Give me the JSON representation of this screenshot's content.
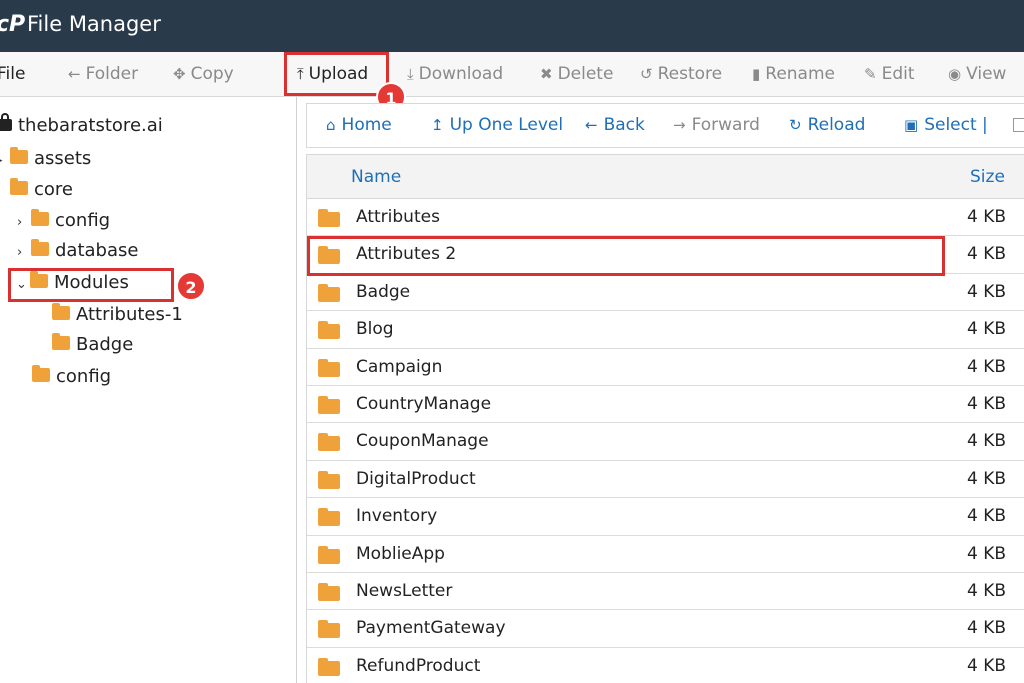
{
  "header": {
    "logo": "cP",
    "title": "File Manager"
  },
  "toolbar": {
    "file": "File",
    "folder": "Folder",
    "copy": "Copy",
    "upload": "Upload",
    "download": "Download",
    "delete": "Delete",
    "restore": "Restore",
    "rename": "Rename",
    "edit": "Edit",
    "view": "View"
  },
  "annotations": {
    "badge1": "1",
    "badge2": "2"
  },
  "sidebar": {
    "root": "thebaratstore.ai",
    "items": [
      "assets",
      "core",
      "config",
      "database",
      "Modules",
      "Attributes-1",
      "Badge",
      "config"
    ]
  },
  "nav": {
    "home": "Home",
    "up": "Up One Level",
    "back": "Back",
    "forward": "Forward",
    "reload": "Reload",
    "select": "Select |"
  },
  "table": {
    "headers": {
      "name": "Name",
      "size": "Size"
    },
    "rows": [
      {
        "name": "Attributes",
        "size": "4 KB"
      },
      {
        "name": "Attributes 2",
        "size": "4 KB"
      },
      {
        "name": "Badge",
        "size": "4 KB"
      },
      {
        "name": "Blog",
        "size": "4 KB"
      },
      {
        "name": "Campaign",
        "size": "4 KB"
      },
      {
        "name": "CountryManage",
        "size": "4 KB"
      },
      {
        "name": "CouponManage",
        "size": "4 KB"
      },
      {
        "name": "DigitalProduct",
        "size": "4 KB"
      },
      {
        "name": "Inventory",
        "size": "4 KB"
      },
      {
        "name": "MoblieApp",
        "size": "4 KB"
      },
      {
        "name": "NewsLetter",
        "size": "4 KB"
      },
      {
        "name": "PaymentGateway",
        "size": "4 KB"
      },
      {
        "name": "RefundProduct",
        "size": "4 KB"
      }
    ]
  },
  "colors": {
    "header_bg": "#293a4a",
    "accent": "#1e6fb8",
    "highlight": "#d93030",
    "folder": "#f0a23a"
  }
}
